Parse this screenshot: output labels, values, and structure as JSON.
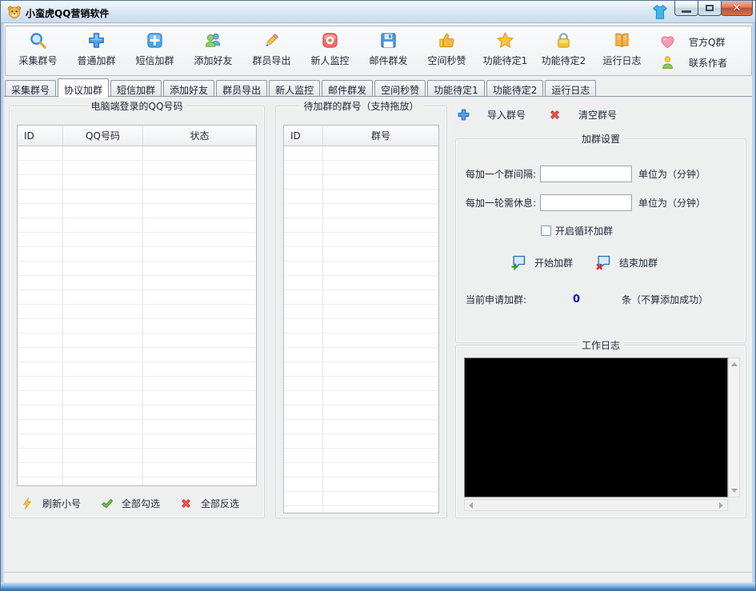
{
  "window": {
    "title": "小蛮虎QQ营销软件"
  },
  "toolbar": {
    "items": [
      {
        "label": "采集群号",
        "icon": "search-icon"
      },
      {
        "label": "普通加群",
        "icon": "plus-icon"
      },
      {
        "label": "短信加群",
        "icon": "plus-square-icon"
      },
      {
        "label": "添加好友",
        "icon": "users-icon"
      },
      {
        "label": "群员导出",
        "icon": "pencil-icon"
      },
      {
        "label": "新人监控",
        "icon": "record-icon"
      },
      {
        "label": "邮件群发",
        "icon": "floppy-icon"
      },
      {
        "label": "空间秒赞",
        "icon": "thumbs-up-icon"
      },
      {
        "label": "功能待定1",
        "icon": "star-icon"
      },
      {
        "label": "功能待定2",
        "icon": "lock-icon"
      },
      {
        "label": "运行日志",
        "icon": "book-icon"
      }
    ],
    "right": [
      {
        "label": "官方Q群",
        "icon": "heart-icon"
      },
      {
        "label": "联系作者",
        "icon": "person-icon"
      }
    ]
  },
  "tabs": {
    "items": [
      "采集群号",
      "协议加群",
      "短信加群",
      "添加好友",
      "群员导出",
      "新人监控",
      "邮件群发",
      "空间秒赞",
      "功能待定1",
      "功能待定2",
      "运行日志"
    ],
    "active_index": 1
  },
  "left_panel": {
    "title": "电脑端登录的QQ号码",
    "columns": [
      "ID",
      "QQ号码",
      "状态"
    ],
    "rows": [],
    "buttons": [
      {
        "label": "刷新小号",
        "icon": "lightning-icon"
      },
      {
        "label": "全部勾选",
        "icon": "check-icon"
      },
      {
        "label": "全部反选",
        "icon": "red-x-icon"
      }
    ]
  },
  "middle_panel": {
    "title": "待加群的群号（支持拖放）",
    "columns": [
      "ID",
      "群号"
    ],
    "rows": []
  },
  "right_panel": {
    "import_button": "导入群号",
    "clear_button": "清空群号",
    "settings": {
      "title": "加群设置",
      "interval_label": "每加一个群间隔:",
      "interval_value": "",
      "interval_unit": "单位为（分钟）",
      "rest_label": "每加一轮需休息:",
      "rest_value": "",
      "rest_unit": "单位为（分钟）",
      "loop_checkbox_label": "开启循环加群",
      "loop_checked": false,
      "start_button": "开始加群",
      "stop_button": "结束加群",
      "counter_label": "当前申请加群:",
      "counter_value": "0",
      "counter_suffix": "条（不算添加成功）"
    },
    "log": {
      "title": "工作日志",
      "content": ""
    }
  },
  "colors": {
    "accent_blue": "#2a7fd4",
    "counter_blue": "#0000d4",
    "close_red": "#c14f30",
    "log_background": "#000000"
  }
}
